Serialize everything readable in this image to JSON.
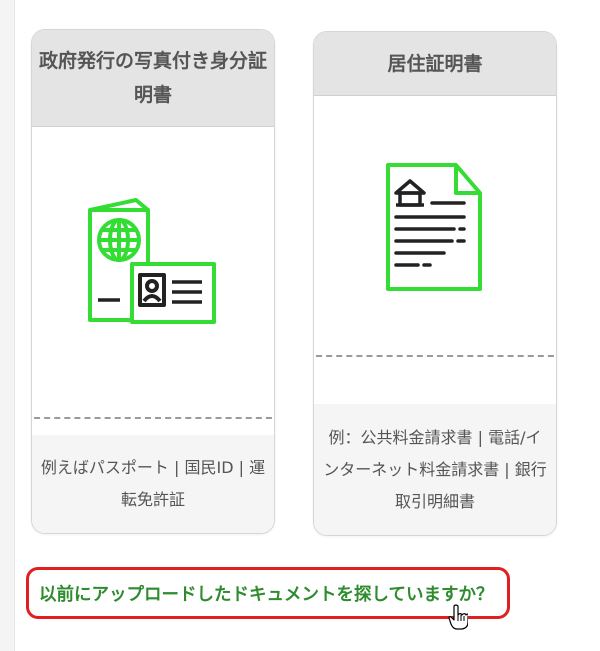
{
  "colors": {
    "accent": "#33dd33",
    "link": "#2e8b2e",
    "highlight": "#e02020"
  },
  "cards": [
    {
      "title": "政府発行の写真付き身分証明書",
      "icon": "id-document-icon",
      "footer": "例えばパスポート | 国民ID | 運転免許証"
    },
    {
      "title": "居住証明書",
      "icon": "residence-document-icon",
      "footer": "例：公共料金請求書 | 電話/インターネット料金請求書 | 銀行取引明細書"
    }
  ],
  "previous_upload_link": "以前にアップロードしたドキュメントを探していますか？",
  "cursor": "hand-pointer-icon"
}
